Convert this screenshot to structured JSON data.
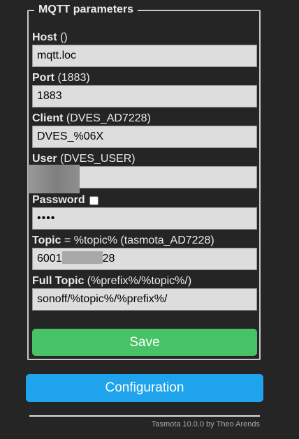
{
  "section": {
    "legend": "MQTT parameters"
  },
  "fields": {
    "host": {
      "label": "Host",
      "hint": " ()",
      "value": "mqtt.loc"
    },
    "port": {
      "label": "Port",
      "hint": " (1883)",
      "value": "1883"
    },
    "client": {
      "label": "Client",
      "hint": " (DVES_AD7228)",
      "value": "DVES_%06X"
    },
    "user": {
      "label": "User",
      "hint": " (DVES_USER)",
      "value": ""
    },
    "password": {
      "label": "Password",
      "value": "••••"
    },
    "topic": {
      "label": "Topic",
      "hint": " = %topic% (tasmota_AD7228)",
      "value_start": "6001",
      "value_end": "28"
    },
    "full_topic": {
      "label": "Full Topic",
      "hint": " (%prefix%/%topic%/)",
      "value": "sonoff/%topic%/%prefix%/"
    }
  },
  "buttons": {
    "save": "Save",
    "configuration": "Configuration"
  },
  "footer": {
    "text": "Tasmota 10.0.0 by Theo Arends"
  },
  "colors": {
    "background": "#252525",
    "save": "#47c266",
    "configuration": "#1fa3ec",
    "input": "#dddddd"
  }
}
